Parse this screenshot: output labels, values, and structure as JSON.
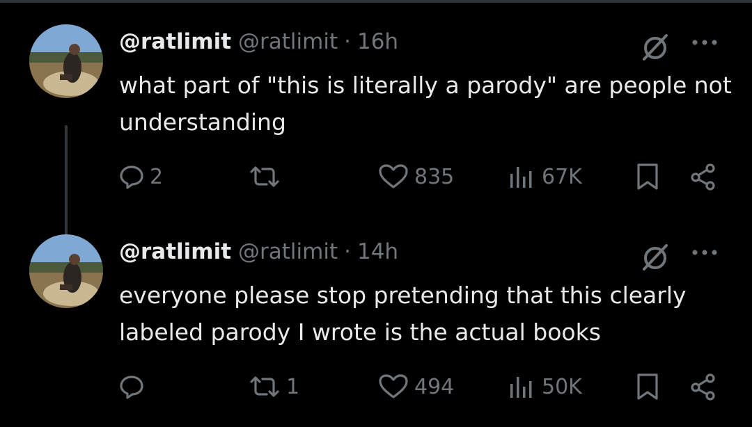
{
  "tweets": [
    {
      "display_name": "@ratlimit",
      "handle": "@ratlimit",
      "separator": "·",
      "time": "16h",
      "text": "what part of \"this is literally a parody\" are people not understanding",
      "replies": "2",
      "retweets": "",
      "likes": "835",
      "views": "67K"
    },
    {
      "display_name": "@ratlimit",
      "handle": "@ratlimit",
      "separator": "·",
      "time": "14h",
      "text": "everyone please stop pretending that this clearly labeled parody I wrote is the actual books",
      "replies": "",
      "retweets": "1",
      "likes": "494",
      "views": "50K"
    }
  ],
  "icons": {
    "grok": "grok-icon",
    "more": "more-icon",
    "reply": "reply-icon",
    "retweet": "retweet-icon",
    "like": "heart-icon",
    "views": "views-icon",
    "bookmark": "bookmark-icon",
    "share": "share-icon"
  },
  "colors": {
    "background": "#000000",
    "text": "#e7e9ea",
    "muted": "#71767b",
    "thread_line": "#333639"
  }
}
